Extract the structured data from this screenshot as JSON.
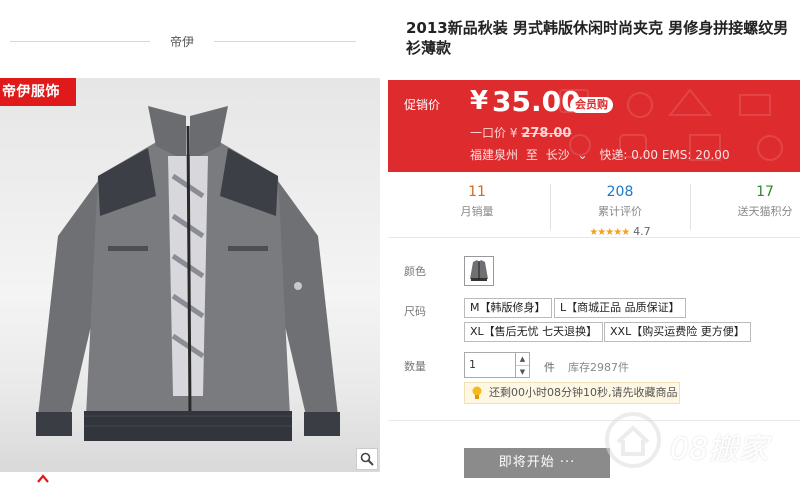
{
  "shop": {
    "name": "帝伊",
    "brand_tag": "帝伊服饰"
  },
  "product": {
    "title": "2013新品秋装 男式韩版休闲时尚夹克 男修身拼接螺纹男衫薄款"
  },
  "price": {
    "promo_label": "促销价",
    "currency": "¥",
    "promo_price": "35.00",
    "member_badge": "会员购",
    "orig_label": "一口价",
    "orig_currency": "¥",
    "orig_price": "278.00",
    "from": "福建泉州",
    "to_label": "至",
    "to": "长沙",
    "shipping": "快递: 0.00 EMS: 20.00"
  },
  "stats": {
    "monthly_sales": {
      "value": "11",
      "label": "月销量"
    },
    "reviews": {
      "value": "208",
      "label": "累计评价",
      "rating": "4.7",
      "stars": "★★★★★"
    },
    "points": {
      "value": "17",
      "label": "送天猫积分"
    }
  },
  "options": {
    "color_label": "颜色",
    "size_label": "尺码",
    "sizes": [
      "M【韩版修身】",
      "L【商城正品 品质保证】",
      "XL【售后无忧 七天退换】",
      "XXL【购买运费险 更方便】"
    ],
    "qty_label": "数量",
    "qty_value": "1",
    "qty_unit": "件",
    "stock": "库存2987件",
    "notice": "还剩00小时08分钟10秒,请先收藏商品"
  },
  "buy": {
    "label": "即将开始 ···"
  },
  "watermark": {
    "text": "08搬家"
  },
  "colors": {
    "red": "#de2b2e",
    "tag_red": "#e01a1a",
    "orange_num": "#d2691e",
    "blue_num": "#1e78c8",
    "green_num": "#2a8a2a"
  }
}
